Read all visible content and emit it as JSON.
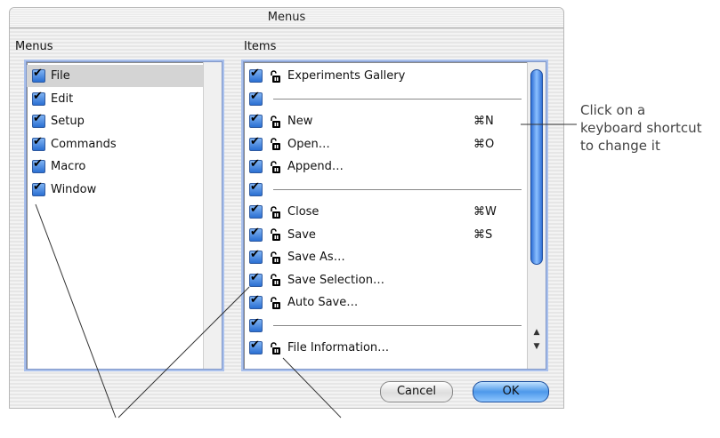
{
  "window": {
    "title": "Menus"
  },
  "menus_panel": {
    "label": "Menus",
    "items": [
      {
        "label": "File",
        "checked": true,
        "selected": true
      },
      {
        "label": "Edit",
        "checked": true
      },
      {
        "label": "Setup",
        "checked": true
      },
      {
        "label": "Commands",
        "checked": true
      },
      {
        "label": "Macro",
        "checked": true
      },
      {
        "label": "Window",
        "checked": true
      }
    ]
  },
  "items_panel": {
    "label": "Items",
    "rows": [
      {
        "type": "item",
        "label": "Experiments Gallery",
        "shortcut": "",
        "locked": true
      },
      {
        "type": "separator"
      },
      {
        "type": "item",
        "label": "New",
        "shortcut": "⌘N",
        "locked": true
      },
      {
        "type": "item",
        "label": "Open…",
        "shortcut": "⌘O",
        "locked": true
      },
      {
        "type": "item",
        "label": "Append…",
        "shortcut": "",
        "locked": true
      },
      {
        "type": "separator"
      },
      {
        "type": "item",
        "label": "Close",
        "shortcut": "⌘W",
        "locked": true
      },
      {
        "type": "item",
        "label": "Save",
        "shortcut": "⌘S",
        "locked": true
      },
      {
        "type": "item",
        "label": "Save As…",
        "shortcut": "",
        "locked": true
      },
      {
        "type": "item",
        "label": "Save Selection…",
        "shortcut": "",
        "locked": true
      },
      {
        "type": "item",
        "label": "Auto Save…",
        "shortcut": "",
        "locked": true
      },
      {
        "type": "separator"
      },
      {
        "type": "item",
        "label": "File Information…",
        "shortcut": "",
        "locked": true
      }
    ]
  },
  "buttons": {
    "cancel": "Cancel",
    "ok": "OK"
  },
  "callout": {
    "line1": "Click on a",
    "line2": "keyboard shortcut",
    "line3": "to change it"
  },
  "colors": {
    "accent": "#3b7de0",
    "selection": "#d4d4d4"
  },
  "icons": {
    "checkbox": "checkbox-checked-icon",
    "lock": "padlock-open-icon"
  }
}
